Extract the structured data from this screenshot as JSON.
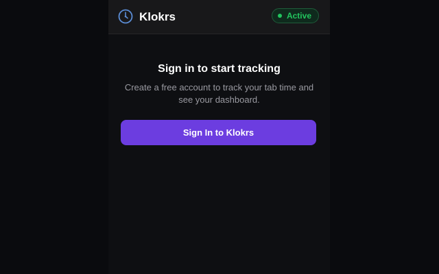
{
  "header": {
    "brand": "Klokrs",
    "logo_icon": "clock-icon",
    "status": {
      "label": "Active",
      "color": "#22c55e"
    }
  },
  "main": {
    "title": "Sign in to start tracking",
    "subtitle": "Create a free account to track your tab time and see your dashboard.",
    "signin_label": "Sign In to Klokrs",
    "accent_color": "#6c3de0"
  }
}
